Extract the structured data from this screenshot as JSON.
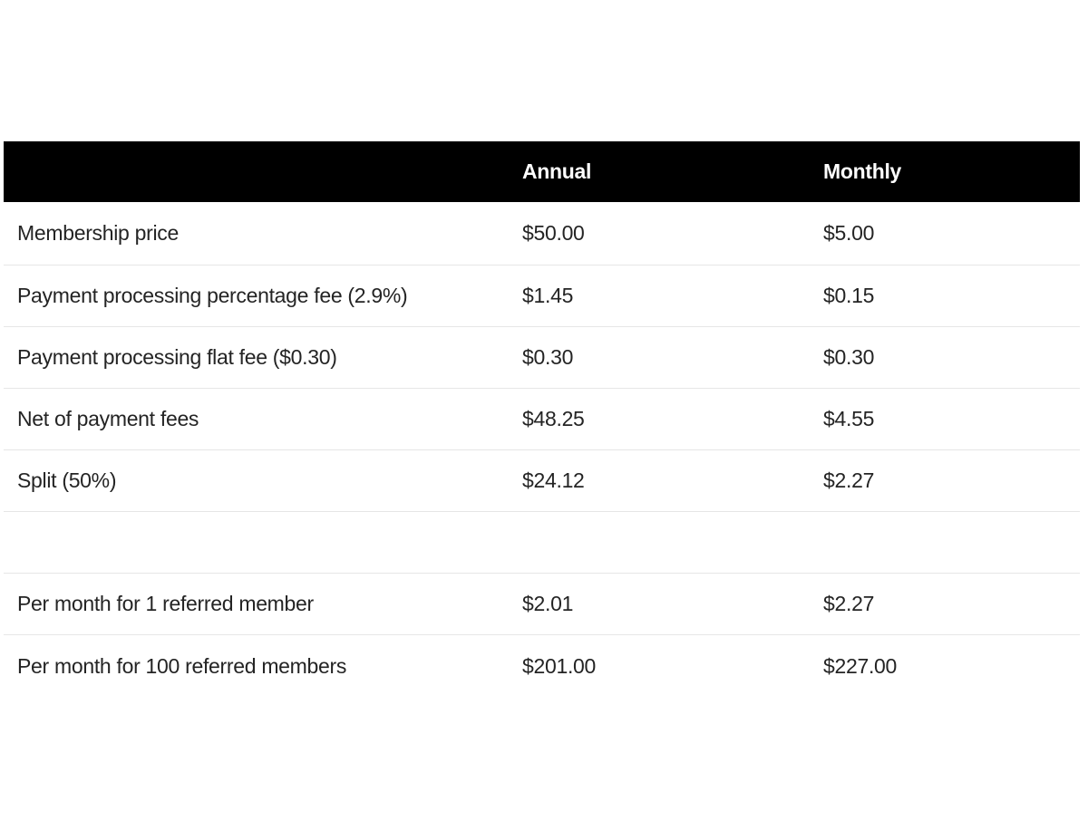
{
  "table": {
    "headers": [
      "",
      "Annual",
      "Monthly"
    ],
    "rows": [
      {
        "label": "Membership price",
        "annual": "$50.00",
        "monthly": "$5.00"
      },
      {
        "label": "Payment processing percentage fee (2.9%)",
        "annual": "$1.45",
        "monthly": "$0.15"
      },
      {
        "label": "Payment processing flat fee ($0.30)",
        "annual": "$0.30",
        "monthly": "$0.30"
      },
      {
        "label": "Net of payment fees",
        "annual": "$48.25",
        "monthly": "$4.55"
      },
      {
        "label": "Split (50%)",
        "annual": "$24.12",
        "monthly": "$2.27"
      },
      {
        "label": "",
        "annual": "",
        "monthly": ""
      },
      {
        "label": "Per month for 1 referred member",
        "annual": "$2.01",
        "monthly": "$2.27"
      },
      {
        "label": "Per month for 100 referred members",
        "annual": "$201.00",
        "monthly": "$227.00"
      }
    ]
  }
}
